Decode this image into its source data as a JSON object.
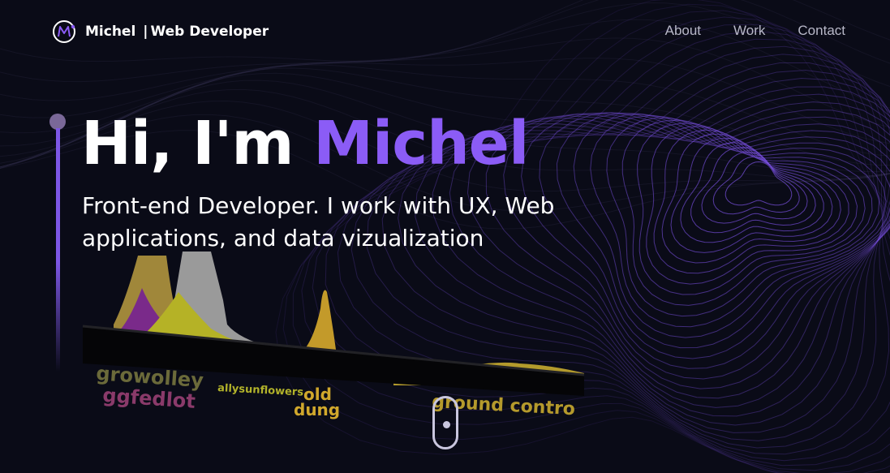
{
  "header": {
    "brand_name": "Michel",
    "brand_separator": "|",
    "brand_role": "Web Developer",
    "nav": [
      {
        "label": "About"
      },
      {
        "label": "Work"
      },
      {
        "label": "Contact"
      }
    ]
  },
  "hero": {
    "greeting": "Hi, I'm",
    "name": "Michel",
    "subtitle": "Front-end Developer. I work with UX, Web applications, and data vizualization"
  },
  "visualization": {
    "labels": [
      "growolley",
      "ggfedlot",
      "allysunflowers",
      "old",
      "dung",
      "ground contro"
    ]
  },
  "colors": {
    "accent": "#8b5cf6",
    "background": "#0a0b17",
    "nav_text": "#b8b8c8"
  },
  "icons": {
    "logo": "m-circle-logo-icon",
    "scroll": "mouse-scroll-icon"
  }
}
